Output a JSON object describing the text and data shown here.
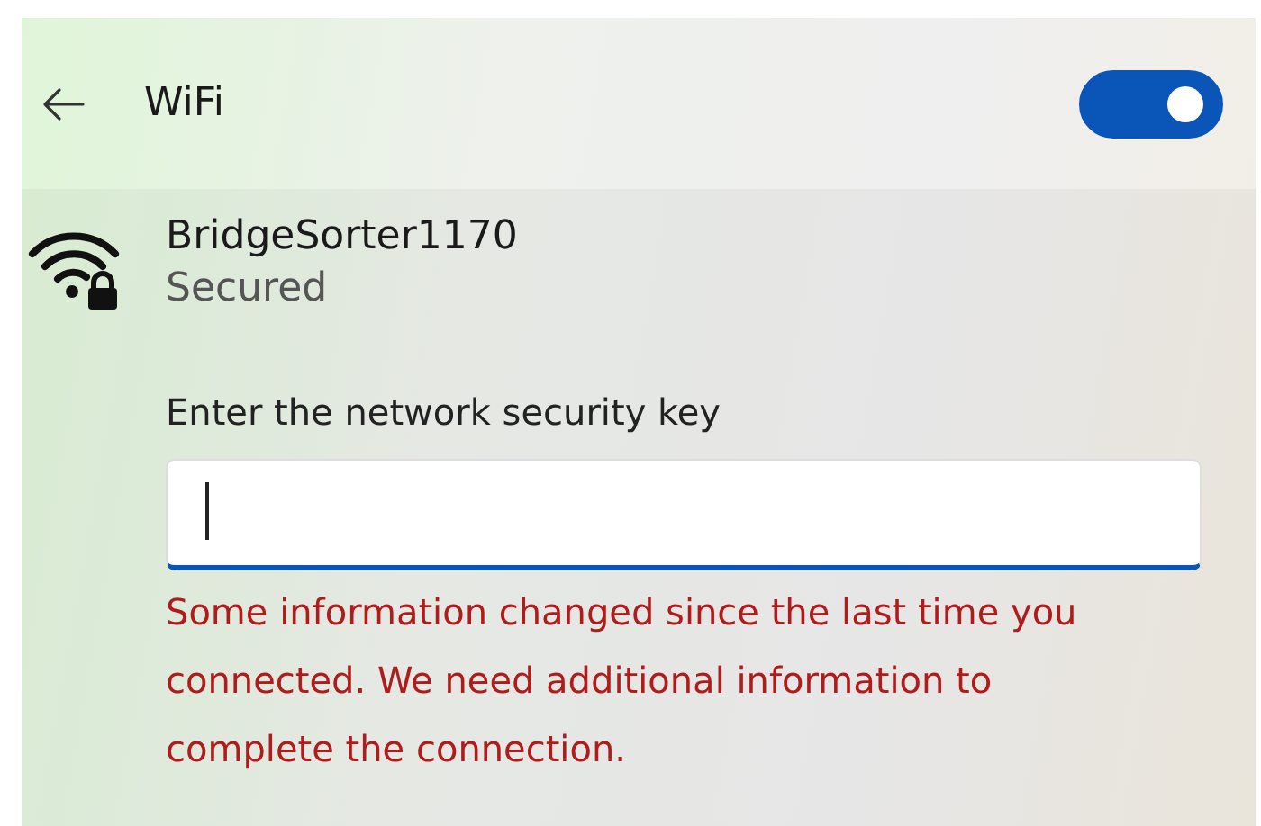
{
  "header": {
    "title": "WiFi",
    "toggle": {
      "on": true
    }
  },
  "network": {
    "name": "BridgeSorter1170",
    "status": "Secured",
    "secured": true
  },
  "key_field": {
    "label": "Enter the network security key",
    "focused": true
  },
  "error": "Some information changed since the last time you connected. We need additional information to complete the connection."
}
